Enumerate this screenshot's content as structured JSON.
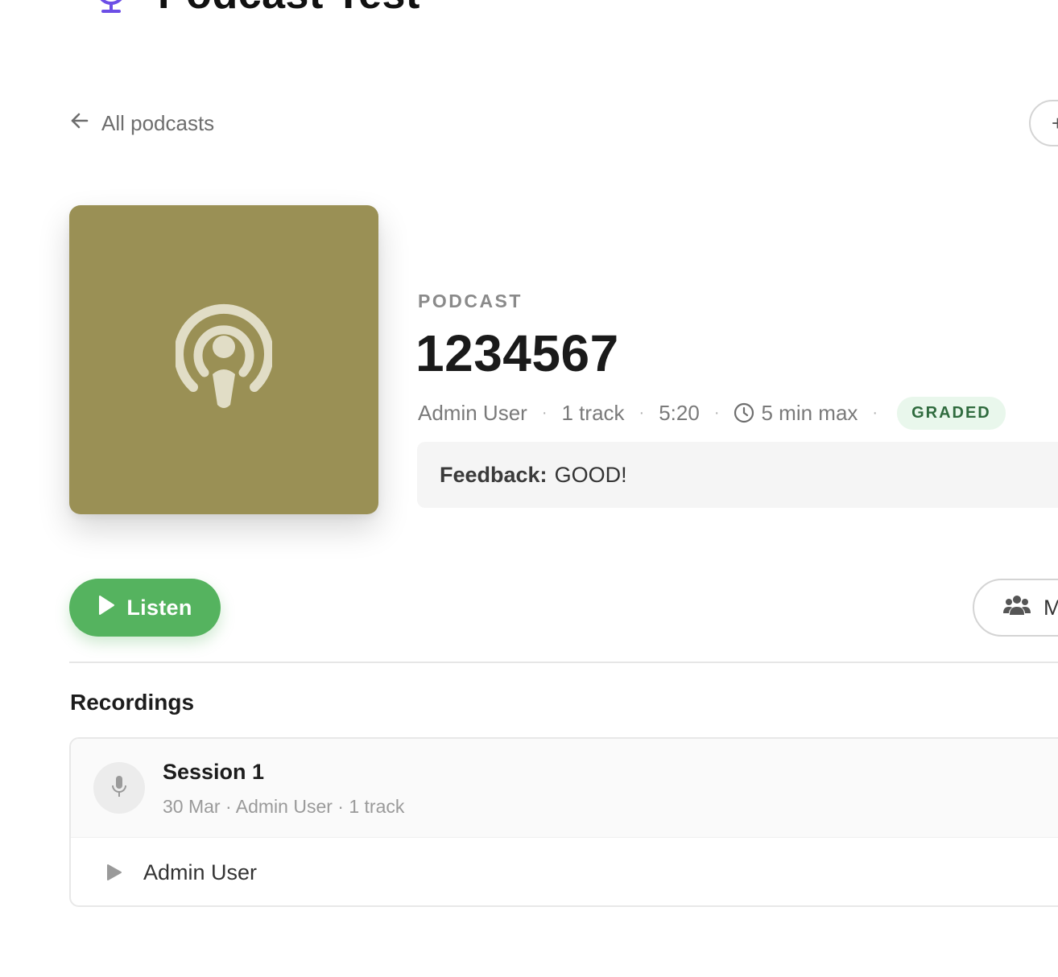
{
  "app": {
    "heading": "Podcast Test",
    "heading_icon": "microphone-icon"
  },
  "nav": {
    "back_label": "All podcasts",
    "top_right_button": "+"
  },
  "podcast": {
    "kicker": "PODCAST",
    "title": "1234567",
    "author": "Admin User",
    "tracks": "1 track",
    "duration": "5:20",
    "limit": "5 min max",
    "status_badge": "GRADED",
    "separator": "·",
    "cover_color": "#9a9055",
    "cover_icon": "podcast-icon"
  },
  "feedback": {
    "label": "Feedback:",
    "text": "GOOD!"
  },
  "actions": {
    "listen_label": "Listen",
    "members_label": "M",
    "accent_color": "#55b35f"
  },
  "recordings": {
    "title": "Recordings",
    "sessions": [
      {
        "name": "Session 1",
        "meta": "30 Mar · Admin User · 1 track",
        "tracks": [
          {
            "name": "Admin User"
          }
        ]
      }
    ]
  }
}
